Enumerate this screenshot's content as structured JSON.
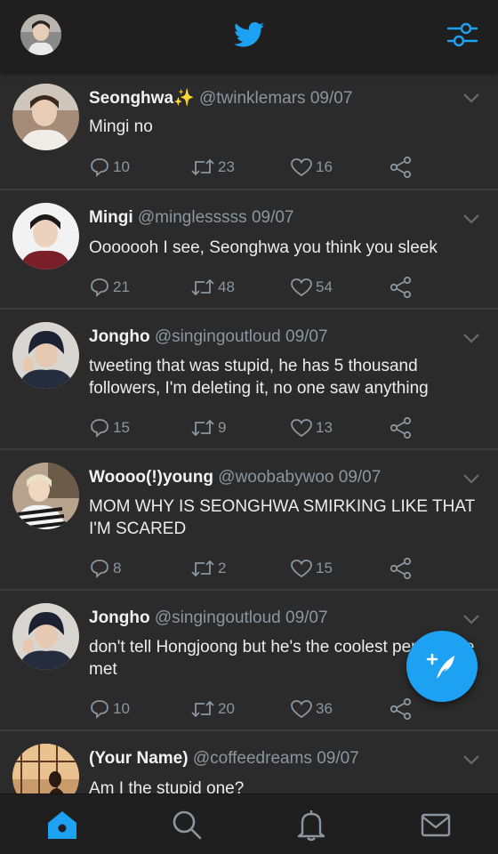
{
  "header": {
    "profile_avatar": "profile-avatar",
    "logo_icon": "twitter-bird-icon",
    "filter_icon": "sliders-icon"
  },
  "colors": {
    "accent": "#1da1f2",
    "background": "#2b2b2b",
    "bar": "#1f1f1f",
    "muted": "#8b96a0"
  },
  "tweets": [
    {
      "name": "Seonghwa",
      "badge": "✨",
      "handle": "@twinklemars",
      "date": "09/07",
      "text": "Mingi no",
      "replies": "10",
      "retweets": "23",
      "likes": "16"
    },
    {
      "name": "Mingi",
      "handle": "@minglesssss",
      "date": "09/07",
      "text": "Ooooooh I see, Seonghwa you think you sleek",
      "replies": "21",
      "retweets": "48",
      "likes": "54"
    },
    {
      "name": "Jongho",
      "handle": "@singingoutloud",
      "date": "09/07",
      "text": "tweeting that was stupid, he has 5 thousand followers, I'm deleting it, no one saw anything",
      "replies": "15",
      "retweets": "9",
      "likes": "13"
    },
    {
      "name": "Woooo(!)young",
      "handle": "@woobabywoo",
      "date": "09/07",
      "text": "MOM WHY IS SEONGHWA SMIRKING LIKE THAT I'M SCARED",
      "replies": "8",
      "retweets": "2",
      "likes": "15"
    },
    {
      "name": "Jongho",
      "handle": "@singingoutloud",
      "date": "09/07",
      "text": "don't tell Hongjoong but he's the coolest person I've met",
      "replies": "10",
      "retweets": "20",
      "likes": "36"
    },
    {
      "name": "(Your Name)",
      "handle": "@coffeedreams",
      "date": "09/07",
      "text": "Am I the stupid one?"
    }
  ],
  "fab": {
    "icon": "compose-feather-icon"
  },
  "bottom_nav": [
    "home-icon",
    "search-icon",
    "bell-icon",
    "mail-icon"
  ]
}
